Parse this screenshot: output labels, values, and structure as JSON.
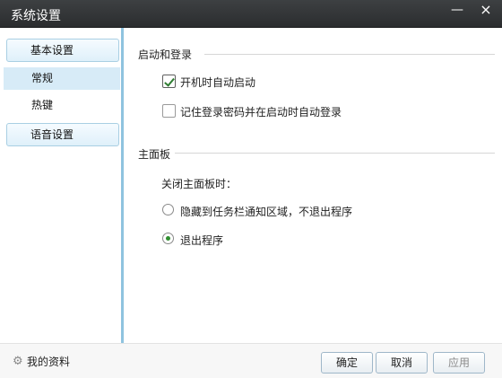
{
  "window": {
    "title": "系统设置",
    "minimize_icon": "—",
    "close_icon": "×"
  },
  "sidebar": {
    "groups": [
      {
        "label": "基本设置"
      },
      {
        "label": "语音设置"
      }
    ],
    "items": [
      {
        "label": "常规",
        "selected": true
      },
      {
        "label": "热键",
        "selected": false
      }
    ]
  },
  "main": {
    "startup_section": "启动和登录",
    "checkbox1": {
      "label": "开机时自动启动",
      "checked": true
    },
    "checkbox2": {
      "label": "记住登录密码并在启动时自动登录",
      "checked": false
    },
    "panel_section": "主面板",
    "close_prompt": "关闭主面板时：",
    "radio1": {
      "label": "隐藏到任务栏通知区域，不退出程序",
      "checked": false
    },
    "radio2": {
      "label": "退出程序",
      "checked": true
    }
  },
  "footer": {
    "profile_icon": "⚙",
    "profile_label": "我的资料",
    "ok_label": "确定",
    "cancel_label": "取消",
    "apply_label": "应用"
  }
}
